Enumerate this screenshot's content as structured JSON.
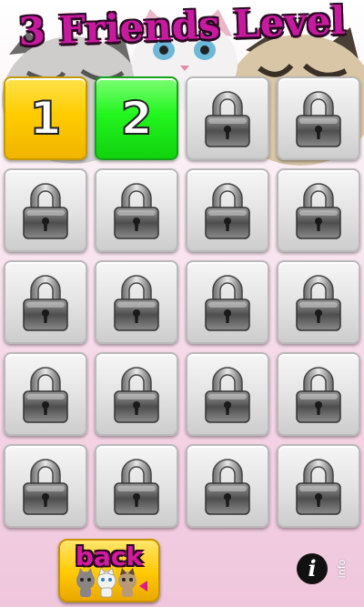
{
  "screen": {
    "title": "3 Friends Level"
  },
  "levels": [
    {
      "label": "1",
      "state": "unlocked",
      "color": "#ffcc00"
    },
    {
      "label": "2",
      "state": "unlocked",
      "color": "#22f51e"
    },
    {
      "label": "",
      "state": "locked"
    },
    {
      "label": "",
      "state": "locked"
    },
    {
      "label": "",
      "state": "locked"
    },
    {
      "label": "",
      "state": "locked"
    },
    {
      "label": "",
      "state": "locked"
    },
    {
      "label": "",
      "state": "locked"
    },
    {
      "label": "",
      "state": "locked"
    },
    {
      "label": "",
      "state": "locked"
    },
    {
      "label": "",
      "state": "locked"
    },
    {
      "label": "",
      "state": "locked"
    },
    {
      "label": "",
      "state": "locked"
    },
    {
      "label": "",
      "state": "locked"
    },
    {
      "label": "",
      "state": "locked"
    },
    {
      "label": "",
      "state": "locked"
    },
    {
      "label": "",
      "state": "locked"
    },
    {
      "label": "",
      "state": "locked"
    },
    {
      "label": "",
      "state": "locked"
    },
    {
      "label": "",
      "state": "locked"
    }
  ],
  "footer": {
    "back_label": "back",
    "info_icon": "i",
    "info_label": "info"
  },
  "icons": {
    "locked_tile": "padlock-icon",
    "back_decoration": "cat-trio-icon",
    "info": "info-icon"
  },
  "colors": {
    "title": "#c81aa0",
    "back_label": "#d21b9f"
  }
}
